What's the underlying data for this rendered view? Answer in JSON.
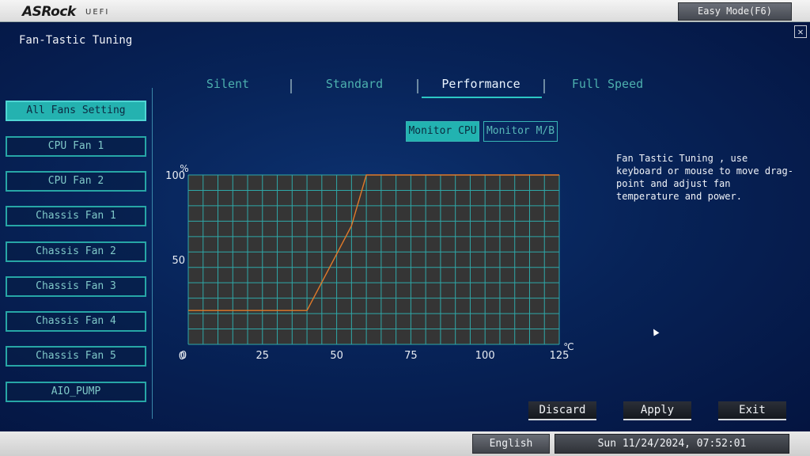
{
  "header": {
    "brand": "ASRock",
    "brand_suffix": "UEFI",
    "easy_mode_label": "Easy Mode(F6)"
  },
  "page": {
    "title": "Fan-Tastic Tuning",
    "close_icon": "close-icon"
  },
  "sidebar": {
    "items": [
      {
        "label": "All Fans Setting",
        "active": true
      },
      {
        "label": "CPU Fan 1"
      },
      {
        "label": "CPU Fan 2"
      },
      {
        "label": "Chassis Fan 1"
      },
      {
        "label": "Chassis Fan 2"
      },
      {
        "label": "Chassis Fan 3"
      },
      {
        "label": "Chassis Fan 4"
      },
      {
        "label": "Chassis Fan 5"
      },
      {
        "label": "AIO_PUMP"
      }
    ]
  },
  "tabs": [
    {
      "label": "Silent"
    },
    {
      "label": "Standard"
    },
    {
      "label": "Performance",
      "active": true
    },
    {
      "label": "Full Speed"
    }
  ],
  "monitor": {
    "cpu_label": "Monitor CPU",
    "mb_label": "Monitor M/B",
    "selected": "Monitor CPU"
  },
  "help_text": "Fan Tastic Tuning , use keyboard or mouse to move drag-point and adjust fan temperature and power.",
  "actions": {
    "discard": "Discard",
    "apply": "Apply",
    "exit": "Exit"
  },
  "footer": {
    "language": "English",
    "datetime": "Sun 11/24/2024, 07:52:01"
  },
  "chart_data": {
    "type": "line",
    "ylabel": "%",
    "xlabel": "℃",
    "xlim": [
      0,
      125
    ],
    "ylim": [
      0,
      100
    ],
    "x_ticks": [
      "0",
      "25",
      "50",
      "75",
      "100",
      "125"
    ],
    "y_ticks": [
      "0",
      "50",
      "100"
    ],
    "series": [
      {
        "x": [
          0,
          40,
          55,
          60,
          125
        ],
        "y": [
          20,
          20,
          70,
          100,
          100
        ],
        "color": "#e07a2a"
      }
    ],
    "grid": true,
    "grid_color": "#2fa8a8",
    "plot_bg": "#353535"
  }
}
